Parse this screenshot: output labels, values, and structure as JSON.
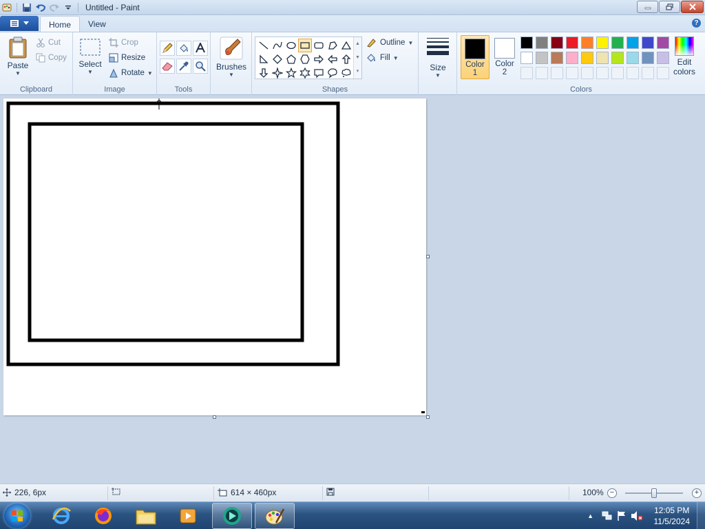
{
  "window": {
    "title": "Untitled - Paint"
  },
  "tabs": [
    {
      "label": "Home"
    },
    {
      "label": "View"
    }
  ],
  "clipboard": {
    "label": "Clipboard",
    "paste": "Paste",
    "cut": "Cut",
    "copy": "Copy"
  },
  "image": {
    "label": "Image",
    "select": "Select",
    "crop": "Crop",
    "resize": "Resize",
    "rotate": "Rotate"
  },
  "tools": {
    "label": "Tools",
    "items": [
      "pencil-icon",
      "fill-bucket-icon",
      "text-icon",
      "eraser-icon",
      "color-picker-icon",
      "magnifier-icon"
    ]
  },
  "brushes": {
    "label": "Brushes"
  },
  "shapes": {
    "label": "Shapes",
    "outline": "Outline",
    "fill": "Fill",
    "items": [
      "line",
      "curve",
      "oval",
      "rectangle",
      "rounded-rectangle",
      "polygon",
      "triangle",
      "right-triangle",
      "diamond",
      "pentagon",
      "hexagon",
      "right-arrow",
      "left-arrow",
      "up-arrow",
      "down-arrow",
      "four-point-star",
      "five-point-star",
      "six-point-star",
      "rounded-callout",
      "oval-callout",
      "cloud-callout"
    ],
    "selected": "rectangle"
  },
  "size": {
    "label": "Size"
  },
  "colors": {
    "label": "Colors",
    "color1": {
      "label_line1": "Color",
      "label_line2": "1",
      "value": "#000000"
    },
    "color2": {
      "label_line1": "Color",
      "label_line2": "2",
      "value": "#ffffff"
    },
    "edit_colors_line1": "Edit",
    "edit_colors_line2": "colors",
    "palette_row1": [
      "#000000",
      "#7f7f7f",
      "#880015",
      "#ed1c24",
      "#ff7f27",
      "#fff200",
      "#22b14c",
      "#00a2e8",
      "#3f48cc",
      "#a349a4"
    ],
    "palette_row2": [
      "#ffffff",
      "#c3c3c3",
      "#b97a57",
      "#ffaec9",
      "#ffc90e",
      "#efe4b0",
      "#b5e61d",
      "#99d9ea",
      "#7092be",
      "#c8bfe7"
    ]
  },
  "statusbar": {
    "cursor_position": "226, 6px",
    "selection_size": "",
    "canvas_size": "614 × 460px",
    "zoom": "100%"
  },
  "taskbar": {
    "apps": [
      "internet-explorer-icon",
      "firefox-icon",
      "file-explorer-icon",
      "media-player-icon",
      "app-icon",
      "paint-icon"
    ],
    "time": "12:05 PM",
    "date": "11/5/2024"
  }
}
